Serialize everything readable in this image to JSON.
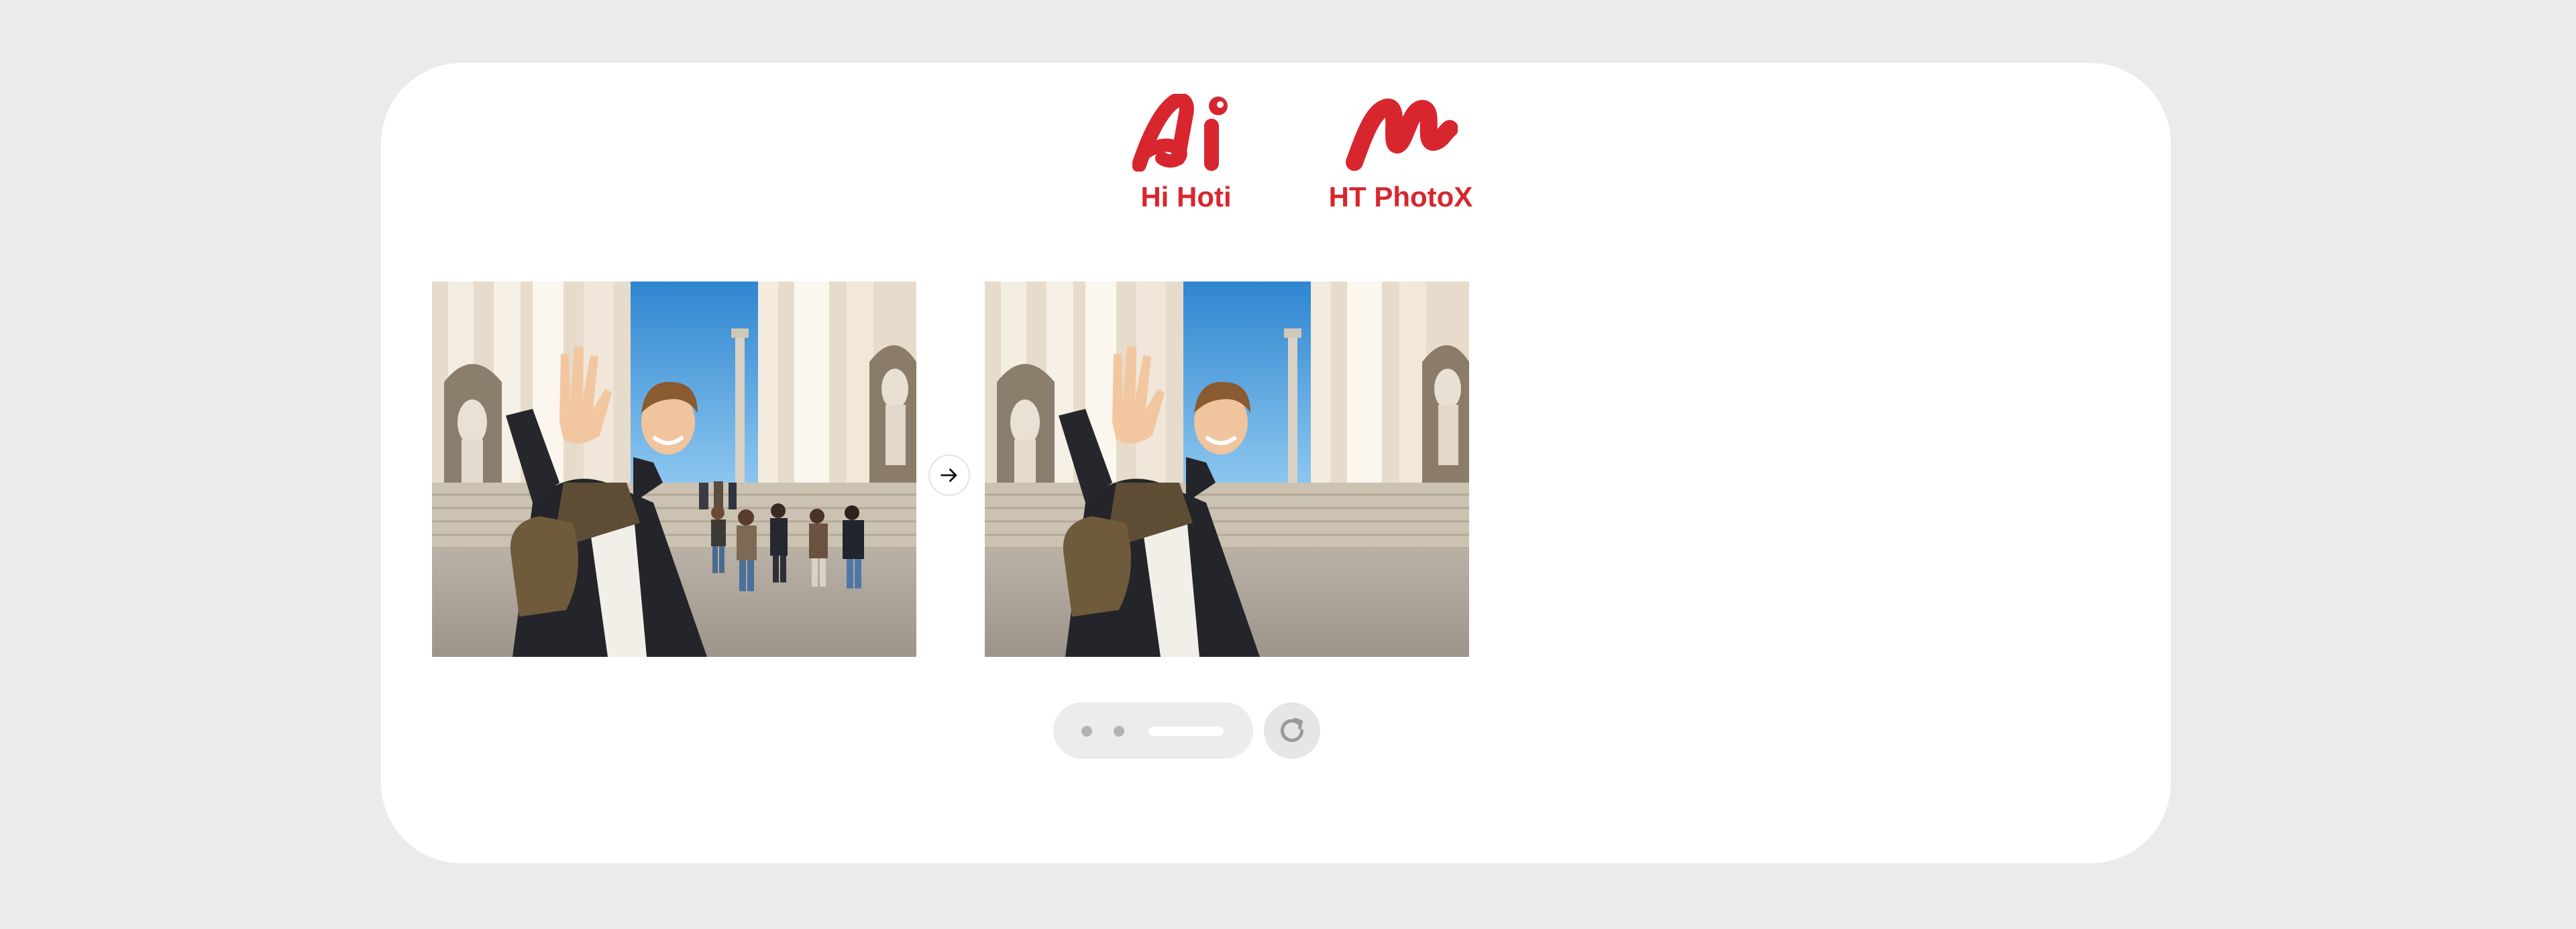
{
  "brands": [
    {
      "name": "Hi Hoti",
      "logo_icon": "hi-hoti-logo-icon"
    },
    {
      "name": "HT PhotoX",
      "logo_icon": "ht-photox-logo-icon"
    }
  ],
  "comparison": {
    "before_image": "photo-before-crowd",
    "after_image": "photo-after-people-removed",
    "arrow_icon": "arrow-right-icon"
  },
  "pager": {
    "slides": 3,
    "active_index": 2,
    "refresh_icon": "refresh-icon"
  },
  "colors": {
    "brand_red": "#d8262e",
    "background": "#ebebeb",
    "card": "#ffffff"
  }
}
